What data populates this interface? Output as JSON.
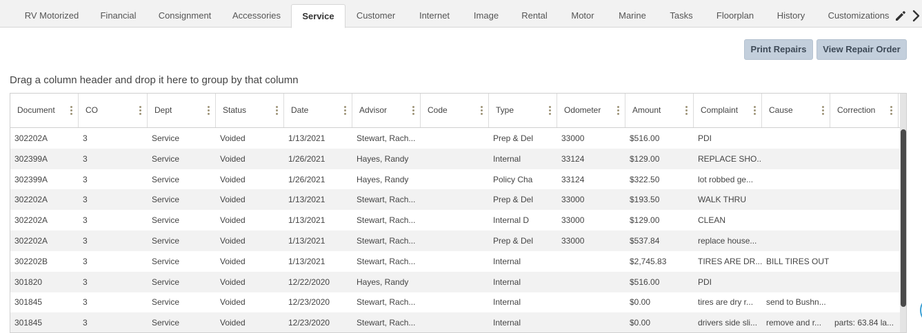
{
  "tabs": [
    {
      "label": "RV Motorized",
      "active": false
    },
    {
      "label": "Financial",
      "active": false
    },
    {
      "label": "Consignment",
      "active": false
    },
    {
      "label": "Accessories",
      "active": false
    },
    {
      "label": "Service",
      "active": true
    },
    {
      "label": "Customer",
      "active": false
    },
    {
      "label": "Internet",
      "active": false
    },
    {
      "label": "Image",
      "active": false
    },
    {
      "label": "Rental",
      "active": false
    },
    {
      "label": "Motor",
      "active": false
    },
    {
      "label": "Marine",
      "active": false
    },
    {
      "label": "Tasks",
      "active": false
    },
    {
      "label": "Floorplan",
      "active": false
    },
    {
      "label": "History",
      "active": false
    },
    {
      "label": "Customizations",
      "active": false
    }
  ],
  "toolbar": {
    "print_repairs": "Print Repairs",
    "view_repair_order": "View Repair Order"
  },
  "group_hint": "Drag a column header and drop it here to group by that column",
  "grid": {
    "columns": [
      "Document",
      "CO",
      "Dept",
      "Status",
      "Date",
      "Advisor",
      "Code",
      "Type",
      "Odometer",
      "Amount",
      "Complaint",
      "Cause",
      "Correction"
    ],
    "rows": [
      [
        "302202A",
        "3",
        "Service",
        "Voided",
        "1/13/2021",
        "Stewart, Rach...",
        "",
        "Prep & Del",
        "33000",
        "$516.00",
        "PDI",
        "",
        ""
      ],
      [
        "302399A",
        "3",
        "Service",
        "Voided",
        "1/26/2021",
        "Hayes, Randy",
        "",
        "Internal",
        "33124",
        "$129.00",
        "REPLACE SHO...",
        "",
        ""
      ],
      [
        "302399A",
        "3",
        "Service",
        "Voided",
        "1/26/2021",
        "Hayes, Randy",
        "",
        "Policy Cha",
        "33124",
        "$322.50",
        "lot robbed ge...",
        "",
        ""
      ],
      [
        "302202A",
        "3",
        "Service",
        "Voided",
        "1/13/2021",
        "Stewart, Rach...",
        "",
        "Prep & Del",
        "33000",
        "$193.50",
        "WALK THRU",
        "",
        ""
      ],
      [
        "302202A",
        "3",
        "Service",
        "Voided",
        "1/13/2021",
        "Stewart, Rach...",
        "",
        "Internal D",
        "33000",
        "$129.00",
        "CLEAN",
        "",
        ""
      ],
      [
        "302202A",
        "3",
        "Service",
        "Voided",
        "1/13/2021",
        "Stewart, Rach...",
        "",
        "Prep & Del",
        "33000",
        "$537.84",
        "replace house...",
        "",
        ""
      ],
      [
        "302202B",
        "3",
        "Service",
        "Voided",
        "1/13/2021",
        "Stewart, Rach...",
        "",
        "Internal",
        "",
        "$2,745.83",
        "TIRES ARE DR...",
        "BILL TIRES OUT",
        ""
      ],
      [
        "301820",
        "3",
        "Service",
        "Voided",
        "12/22/2020",
        "Hayes, Randy",
        "",
        "Internal",
        "",
        "$516.00",
        "PDI",
        "",
        ""
      ],
      [
        "301845",
        "3",
        "Service",
        "Voided",
        "12/23/2020",
        "Stewart, Rach...",
        "",
        "Internal",
        "",
        "$0.00",
        "tires are dry r...",
        "send to Bushn...",
        ""
      ],
      [
        "301845",
        "3",
        "Service",
        "Voided",
        "12/23/2020",
        "Stewart, Rach...",
        "",
        "Internal",
        "",
        "$0.00",
        "drivers side sli...",
        "remove and r...",
        "parts: 63.84 la..."
      ]
    ]
  },
  "icons": {
    "edit": "pencil-icon",
    "scroll": "chevron-right-icon",
    "column_menu": "kebab-icon"
  }
}
